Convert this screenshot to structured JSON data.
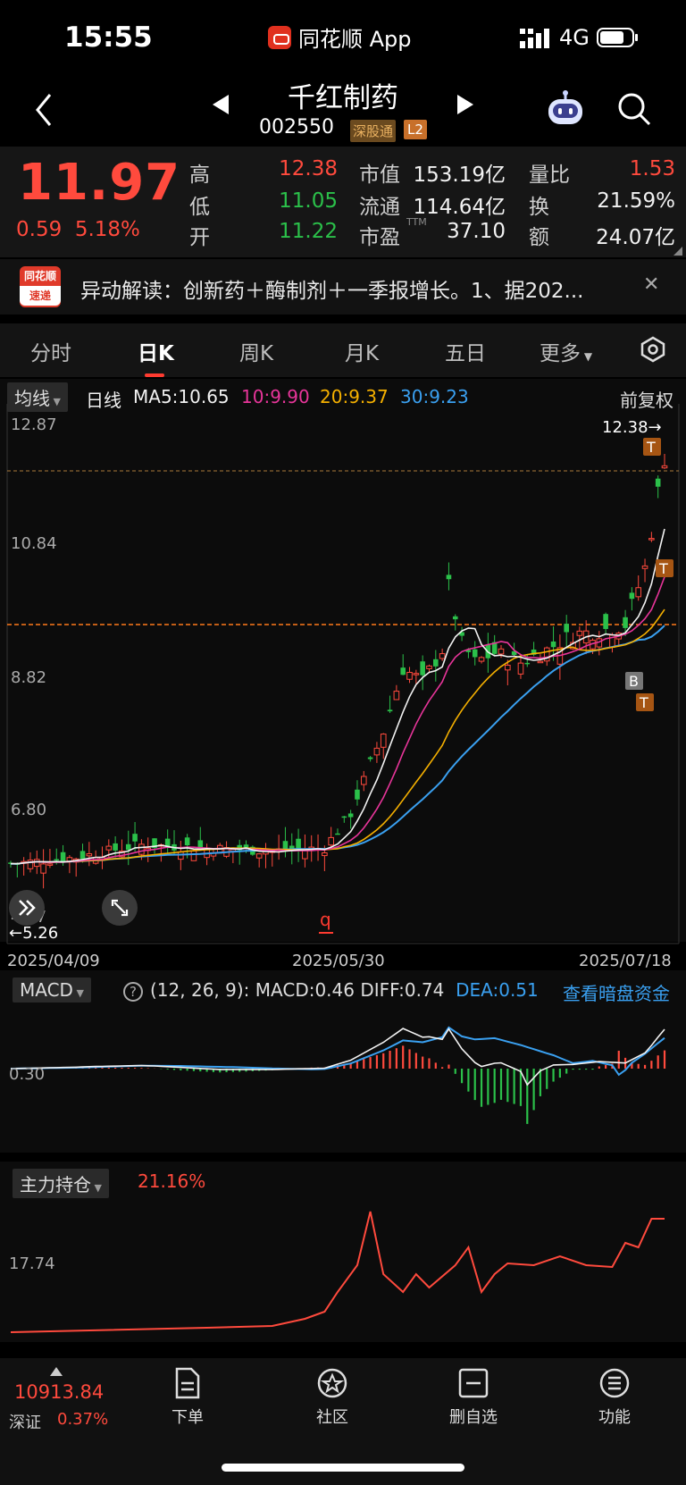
{
  "status_bar": {
    "time": "15:55",
    "app_name": "同花顺 App",
    "network": "4G"
  },
  "header": {
    "stock_name": "千红制药",
    "stock_code": "002550",
    "tag_exchange": "深股通",
    "tag_level": "L2"
  },
  "quote": {
    "price": "11.97",
    "change": "0.59",
    "change_pct": "5.18%",
    "high_label": "高",
    "high": "12.38",
    "low_label": "低",
    "low": "11.05",
    "open_label": "开",
    "open": "11.22",
    "mktcap_label": "市值",
    "mktcap": "153.19亿",
    "float_label": "流通",
    "float": "114.64亿",
    "pe_label": "市盈",
    "pe_sup": "TTM",
    "pe": "37.10",
    "volratio_label": "量比",
    "volratio": "1.53",
    "turnover_label": "换",
    "turnover": "21.59%",
    "amount_label": "额",
    "amount": "24.07亿"
  },
  "news": {
    "logo_line1": "同花顺",
    "logo_line2": "速递",
    "text": "异动解读：创新药＋酶制剂＋一季报增长。1、据202..."
  },
  "tabs": [
    "分时",
    "日K",
    "周K",
    "月K",
    "五日",
    "更多"
  ],
  "ma_bar": {
    "selector": "均线",
    "period": "日线",
    "ma5": "MA5:10.65",
    "ma10": "10:9.90",
    "ma20": "20:9.37",
    "ma30": "30:9.23",
    "adjust": "前复权"
  },
  "kline": {
    "y_labels": [
      "12.87",
      "10.84",
      "8.82",
      "6.80",
      "4.77"
    ],
    "high_mark": "12.38→",
    "low_mark": "←5.26",
    "dates": [
      "2025/04/09",
      "2025/05/30",
      "2025/07/18"
    ],
    "marker_letter": "q",
    "badges": [
      "T",
      "T",
      "B",
      "T"
    ]
  },
  "macd": {
    "selector": "MACD",
    "params": "(12, 26, 9):",
    "macd": "MACD:0.46",
    "diff": "DIFF:0.74",
    "dea": "DEA:0.51",
    "link": "查看暗盘资金",
    "y_label": "0.30"
  },
  "main_force": {
    "selector": "主力持仓",
    "value": "21.16%",
    "y_label": "17.74"
  },
  "bottom": {
    "index_value": "10913.84",
    "index_name": "深证",
    "index_chg": "0.37%",
    "nav": [
      "下单",
      "社区",
      "删自选",
      "功能"
    ]
  },
  "colors": {
    "up": "#ff4a3d",
    "down": "#2bc04a",
    "ma5": "#f2f2f2",
    "ma10": "#e8359a",
    "ma20": "#f5b000",
    "ma30": "#3aa0f0"
  }
}
